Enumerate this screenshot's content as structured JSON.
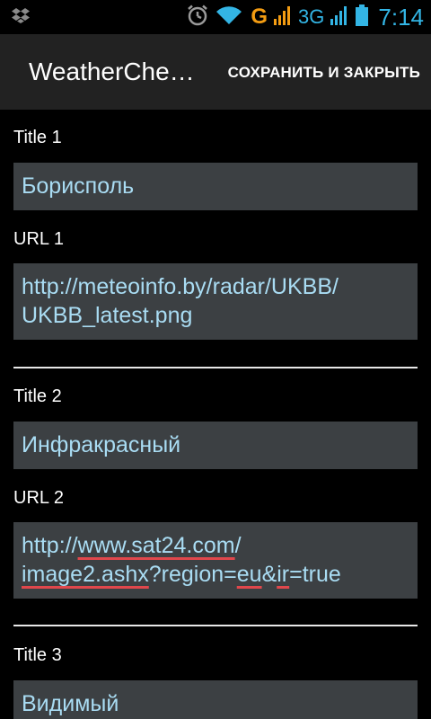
{
  "statusbar": {
    "network_g": "G",
    "network_3g": "3G",
    "time": "7:14",
    "icons": [
      "dropbox-icon",
      "alarm-icon",
      "wifi-icon",
      "signal-icon",
      "battery-icon"
    ],
    "colors": {
      "accent": "#33b5e5",
      "g": "#f39c12"
    }
  },
  "actionbar": {
    "title": "WeatherChe…",
    "action": "СОХРАНИТЬ И ЗАКРЫТЬ"
  },
  "entries": [
    {
      "title_label": "Title 1",
      "title_value": "Борисполь",
      "url_label": "URL 1",
      "url_value": "http://meteoinfo.by/radar/UKBB/UKBB_latest.png"
    },
    {
      "title_label": "Title 2",
      "title_value": "Инфракрасный",
      "url_label": "URL 2",
      "url_value": "http://www.sat24.com/image2.ashx?region=eu&ir=true"
    },
    {
      "title_label": "Title 3",
      "title_value": "Видимый"
    }
  ],
  "colors": {
    "field_bg": "#3c4043",
    "field_text": "#a9dcf3",
    "spellcheck": "#e0474c"
  }
}
